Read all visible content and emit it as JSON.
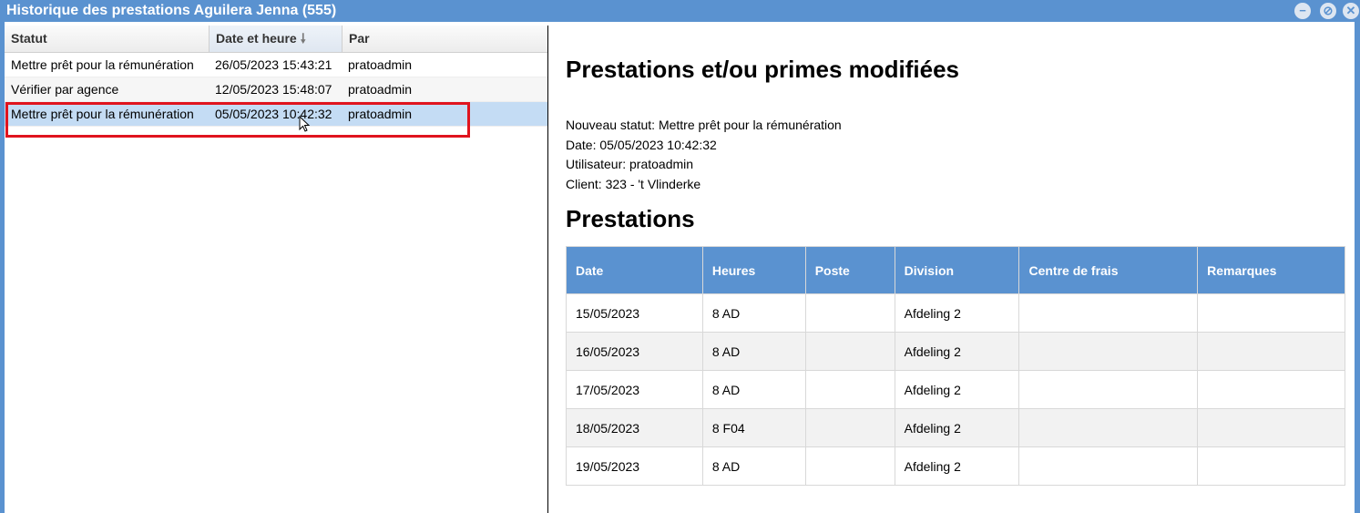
{
  "window": {
    "title": "Historique des prestations Aguilera Jenna (555)",
    "minimize_icon": "minus-circle-icon",
    "restore_icon": "restore-circle-icon",
    "close_icon": "close-circle-icon"
  },
  "history_grid": {
    "columns": [
      "Statut",
      "Date et heure",
      "Par"
    ],
    "sort_icon": "arrow-down-icon",
    "rows": [
      {
        "statut": "Mettre prêt pour la rémunération",
        "date": "26/05/2023 15:43:21",
        "par": "pratoadmin"
      },
      {
        "statut": "Vérifier par agence",
        "date": "12/05/2023 15:48:07",
        "par": "pratoadmin"
      },
      {
        "statut": "Mettre prêt pour la rémunération",
        "date": "05/05/2023 10:42:32",
        "par": "pratoadmin",
        "selected": true
      }
    ]
  },
  "detail": {
    "heading": "Prestations et/ou primes modifiées",
    "info": [
      "Nouveau statut: Mettre prêt pour la rémunération",
      "Date: 05/05/2023 10:42:32",
      "Utilisateur: pratoadmin",
      "Client: 323 - 't Vlinderke"
    ],
    "prestations_heading": "Prestations",
    "table": {
      "headers": [
        "Date",
        "Heures",
        "Poste",
        "Division",
        "Centre de frais",
        "Remarques"
      ],
      "rows": [
        [
          "15/05/2023",
          "8 AD",
          "",
          "Afdeling 2",
          "",
          ""
        ],
        [
          "16/05/2023",
          "8 AD",
          "",
          "Afdeling 2",
          "",
          ""
        ],
        [
          "17/05/2023",
          "8 AD",
          "",
          "Afdeling 2",
          "",
          ""
        ],
        [
          "18/05/2023",
          "8 F04",
          "",
          "Afdeling 2",
          "",
          ""
        ],
        [
          "19/05/2023",
          "8 AD",
          "",
          "Afdeling 2",
          "",
          ""
        ]
      ]
    }
  }
}
